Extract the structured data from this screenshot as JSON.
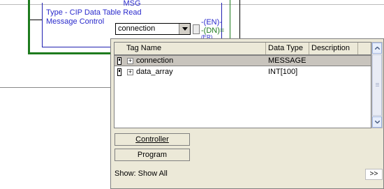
{
  "instruction": {
    "title": "MSG",
    "type_text": "Type - CIP Data Table Read",
    "control_label": "Message Control",
    "control_value": "connection",
    "outputs": {
      "en": "EN",
      "dn": "DN",
      "er": "ER"
    }
  },
  "tag_browser": {
    "columns": [
      "Tag Name",
      "Data Type",
      "Description"
    ],
    "rows": [
      {
        "name": "connection",
        "type": "MESSAGE",
        "description": "",
        "expander": "+"
      },
      {
        "name": "data_array",
        "type": "INT[100]",
        "description": "",
        "expander": "+"
      }
    ],
    "scope_buttons": {
      "controller": "Controller",
      "program": "Program"
    },
    "show_text": "Show: Show All",
    "more_label": ">>"
  },
  "colors": {
    "rung_green": "#1e7b1e",
    "instr_blue": "#2a2acc",
    "selection": "#c8c4bd"
  },
  "icons": [
    "dropdown-arrow-icon",
    "tag-icon",
    "expand-icon",
    "scroll-up-icon",
    "scroll-down-icon"
  ]
}
